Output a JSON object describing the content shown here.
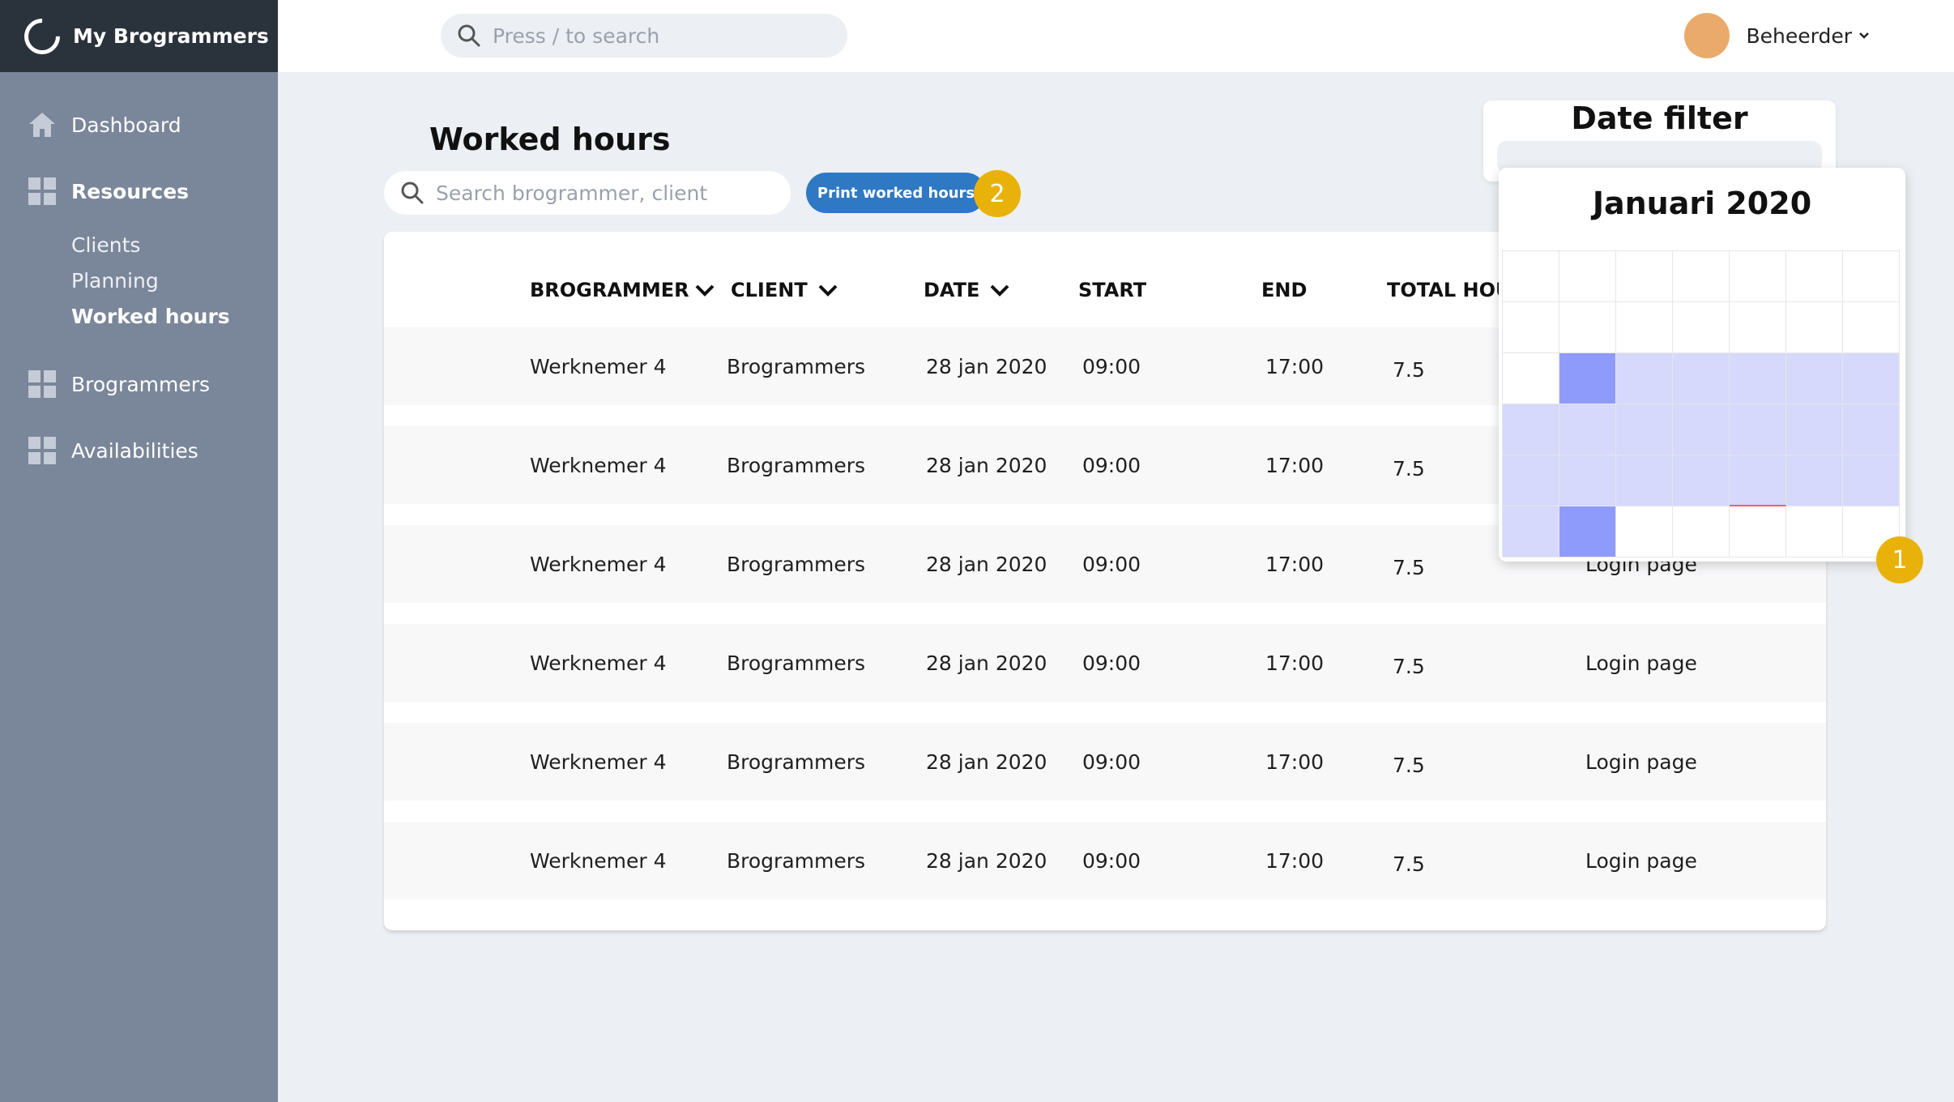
{
  "app": {
    "name": "My Brogrammers"
  },
  "sidebar": {
    "items": [
      {
        "label": "Dashboard",
        "icon": "home-icon"
      },
      {
        "label": "Resources",
        "icon": "grid-icon"
      },
      {
        "label": "Brogrammers",
        "icon": "grid-icon"
      },
      {
        "label": "Availabilities",
        "icon": "grid-icon"
      }
    ],
    "sub_items": [
      {
        "label": "Clients"
      },
      {
        "label": "Planning"
      },
      {
        "label": "Worked hours",
        "active": true
      }
    ]
  },
  "topbar": {
    "search_placeholder": "Press / to search",
    "user_name": "Beheerder",
    "avatar_color": "#eaaa6c"
  },
  "main": {
    "title": "Worked hours",
    "search_placeholder": "Search brogrammer, client",
    "print_label": "Print worked hours",
    "print_badge": "2",
    "accent_color": "#2f78c4",
    "badge_color": "#e9b20a"
  },
  "table": {
    "columns": [
      "BROGRAMMER",
      "CLIENT",
      "DATE",
      "START",
      "END",
      "TOTAL HOU"
    ],
    "rows": [
      [
        "Werknemer 4",
        "Brogrammers",
        "28 jan 2020",
        "09:00",
        "17:00",
        "7.5",
        ""
      ],
      [
        "Werknemer 4",
        "Brogrammers",
        "28 jan 2020",
        "09:00",
        "17:00",
        "7.5",
        ""
      ],
      [
        "Werknemer 4",
        "Brogrammers",
        "28 jan 2020",
        "09:00",
        "17:00",
        "7.5",
        "Login page"
      ],
      [
        "Werknemer 4",
        "Brogrammers",
        "28 jan 2020",
        "09:00",
        "17:00",
        "7.5",
        "Login page"
      ],
      [
        "Werknemer 4",
        "Brogrammers",
        "28 jan 2020",
        "09:00",
        "17:00",
        "7.5",
        "Login page"
      ],
      [
        "Werknemer 4",
        "Brogrammers",
        "28 jan 2020",
        "09:00",
        "17:00",
        "7.5",
        "Login page"
      ]
    ]
  },
  "date_filter": {
    "title": "Date filter",
    "calendar_month": "Januari 2020",
    "badge": "1",
    "range_color": "#d6d9fc",
    "edge_color": "#8f9bfb"
  }
}
